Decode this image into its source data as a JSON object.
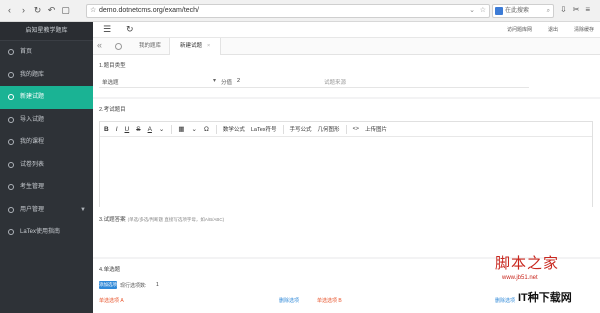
{
  "browser": {
    "url": "demo.dotnetcms.org/exam/tech/",
    "search_placeholder": "在此搜索"
  },
  "sidebar": {
    "brand": "启知星教学题库",
    "items": [
      {
        "label": "首页"
      },
      {
        "label": "我的题库"
      },
      {
        "label": "新建试题",
        "active": true
      },
      {
        "label": "导入试题"
      },
      {
        "label": "我的课程"
      },
      {
        "label": "试卷列表"
      },
      {
        "label": "考生管理"
      },
      {
        "label": "用户管理"
      },
      {
        "label": "LaTex使用指南"
      }
    ]
  },
  "topbar": {
    "links": [
      "访问题库网",
      "退出",
      "清除缓存"
    ]
  },
  "tabs": {
    "items": [
      {
        "label": "我的题库"
      },
      {
        "label": "新建试题",
        "active": true
      }
    ]
  },
  "section1": {
    "title": "1.题目类型",
    "type_value": "单选题",
    "score_label": "分值",
    "score_value": "2",
    "source_placeholder": "试题来源"
  },
  "section2": {
    "title": "2.考试题目",
    "toolbar": {
      "bold": "B",
      "italic": "I",
      "underline": "U",
      "strike": "S",
      "font_color": "A",
      "table": "▦",
      "omega": "Ω",
      "formula": "数学公式",
      "latex": "LaTex符号",
      "handwrite": "手写公式",
      "geometry": "几何图形",
      "code": "<>",
      "upload": "上传图片"
    },
    "powered": "Powered by"
  },
  "section3": {
    "title": "3.试题答案",
    "hint": "(单选/多选/判断题 直接写选项字母，如A/B/ABC)"
  },
  "section4": {
    "title": "4.单选题",
    "add_button": "添加选项",
    "count_label": "现行选项数:",
    "count_value": "1",
    "option_a": "单选选项 A",
    "delete_a": "删除选项",
    "option_b": "单选选项 B",
    "delete_b": "删除选项"
  },
  "watermark": {
    "text": "脚本之家",
    "url": "www.jb51.net",
    "logo": "IT种下载网"
  },
  "colors": {
    "sidebar_bg": "#2e3237",
    "active": "#1ab394",
    "link": "#2f89d8",
    "option": "#e8542b",
    "watermark": "#c8271e"
  }
}
